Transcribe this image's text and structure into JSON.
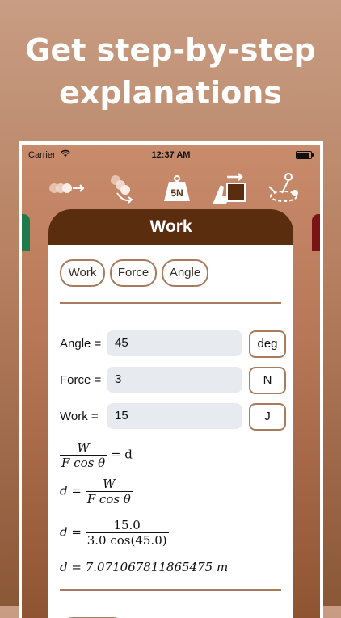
{
  "headline": {
    "line1": "Get step-by-step",
    "line2": "explanations"
  },
  "status_bar": {
    "carrier": "Carrier",
    "time": "12:37 AM"
  },
  "toolbar": {
    "tools": [
      {
        "icon": "momentum-balls-icon"
      },
      {
        "icon": "rotation-icon"
      },
      {
        "icon": "weight-icon",
        "text": "5N"
      },
      {
        "icon": "work-push-icon"
      },
      {
        "icon": "circular-motion-icon"
      }
    ]
  },
  "card": {
    "title": "Work",
    "chips": [
      "Work",
      "Force",
      "Angle"
    ],
    "inputs": [
      {
        "label": "Angle =",
        "value": "45",
        "unit": "deg"
      },
      {
        "label": "Force =",
        "value": "3",
        "unit": "N"
      },
      {
        "label": "Work =",
        "value": "15",
        "unit": "J"
      }
    ],
    "steps": {
      "s1_num": "W",
      "s1_den": "F cos θ",
      "s1_rhs": "= d",
      "s2_lhs": "d =",
      "s2_num": "W",
      "s2_den": "F cos θ",
      "s3_lhs": "d =",
      "s3_num": "15.0",
      "s3_den": "3.0 cos(45.0)",
      "s4": "d = 7.071067811865475 m"
    }
  },
  "colors": {
    "accent": "#a97b5e",
    "header": "#5a2d0f",
    "left_tab": "#1f7a4d",
    "right_tab": "#7a1414"
  }
}
